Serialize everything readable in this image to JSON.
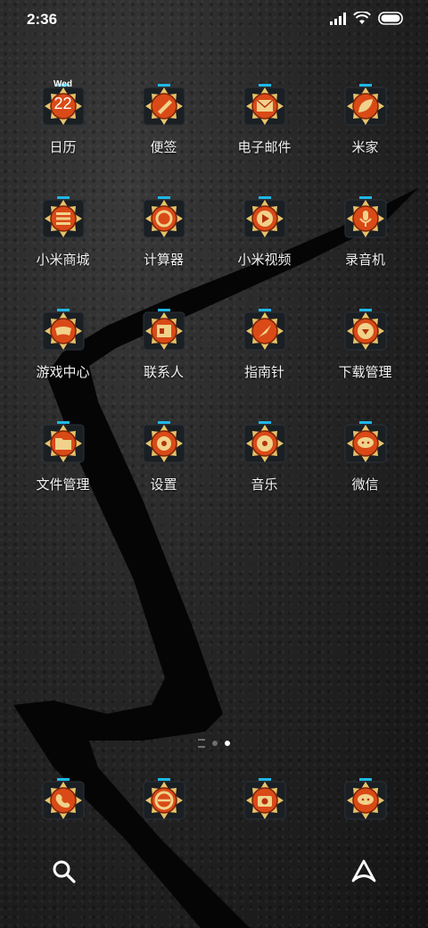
{
  "status_bar": {
    "time": "2:36"
  },
  "apps": [
    {
      "label": "日历",
      "icon": "calendar-icon",
      "glyph": "cal"
    },
    {
      "label": "便签",
      "icon": "notes-icon",
      "glyph": "pen"
    },
    {
      "label": "电子邮件",
      "icon": "email-icon",
      "glyph": "mail"
    },
    {
      "label": "米家",
      "icon": "mijia-icon",
      "glyph": "leaf"
    },
    {
      "label": "小米商城",
      "icon": "mi-store-icon",
      "glyph": "bars"
    },
    {
      "label": "计算器",
      "icon": "calculator-icon",
      "glyph": "circle"
    },
    {
      "label": "小米视频",
      "icon": "video-icon",
      "glyph": "play"
    },
    {
      "label": "录音机",
      "icon": "recorder-icon",
      "glyph": "mic"
    },
    {
      "label": "游戏中心",
      "icon": "game-center-icon",
      "glyph": "pad"
    },
    {
      "label": "联系人",
      "icon": "contacts-icon",
      "glyph": "card"
    },
    {
      "label": "指南针",
      "icon": "compass-icon",
      "glyph": "needle"
    },
    {
      "label": "下载管理",
      "icon": "downloads-icon",
      "glyph": "down"
    },
    {
      "label": "文件管理",
      "icon": "file-manager-icon",
      "glyph": "folder"
    },
    {
      "label": "设置",
      "icon": "settings-icon",
      "glyph": "gear"
    },
    {
      "label": "音乐",
      "icon": "music-icon",
      "glyph": "disc"
    },
    {
      "label": "微信",
      "icon": "wechat-icon",
      "glyph": "chat"
    }
  ],
  "calendar_badge": {
    "day": "Wed",
    "date": "22"
  },
  "page_indicator": {
    "pages": 3,
    "current": 3
  },
  "dock": [
    {
      "icon": "phone-icon",
      "glyph": "phone"
    },
    {
      "icon": "browser-icon",
      "glyph": "e"
    },
    {
      "icon": "camera-icon",
      "glyph": "cam"
    },
    {
      "icon": "messages-icon",
      "glyph": "chat"
    }
  ],
  "bottom_bar": {
    "left_icon": "search-icon",
    "right_icon": "a-shape-icon"
  },
  "colors": {
    "icon_orange": "#d94a17",
    "icon_gold": "#e8c46a",
    "icon_cyan": "#1fb7e8"
  }
}
